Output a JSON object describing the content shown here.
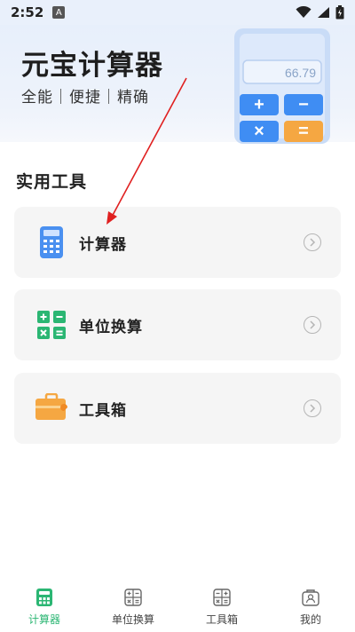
{
  "status_bar": {
    "time": "2:52",
    "notification_badge": "A"
  },
  "hero": {
    "title": "元宝计算器",
    "tagline": "全能｜便捷｜精确",
    "calculator_display": "66.79",
    "calculator_keys": [
      "+",
      "−",
      "×",
      "="
    ]
  },
  "section": {
    "title": "实用工具"
  },
  "tools": [
    {
      "label": "计算器",
      "icon": "calculator-icon"
    },
    {
      "label": "单位换算",
      "icon": "unit-convert-icon"
    },
    {
      "label": "工具箱",
      "icon": "toolbox-icon"
    }
  ],
  "tabbar": {
    "tabs": [
      {
        "label": "计算器",
        "active": true
      },
      {
        "label": "单位换算",
        "active": false
      },
      {
        "label": "工具箱",
        "active": false
      },
      {
        "label": "我的",
        "active": false
      }
    ]
  },
  "colors": {
    "accent_green": "#2bb673",
    "calc_blue": "#3f8df3",
    "toolbox_orange": "#f5a742",
    "arrow_red": "#e02020"
  }
}
